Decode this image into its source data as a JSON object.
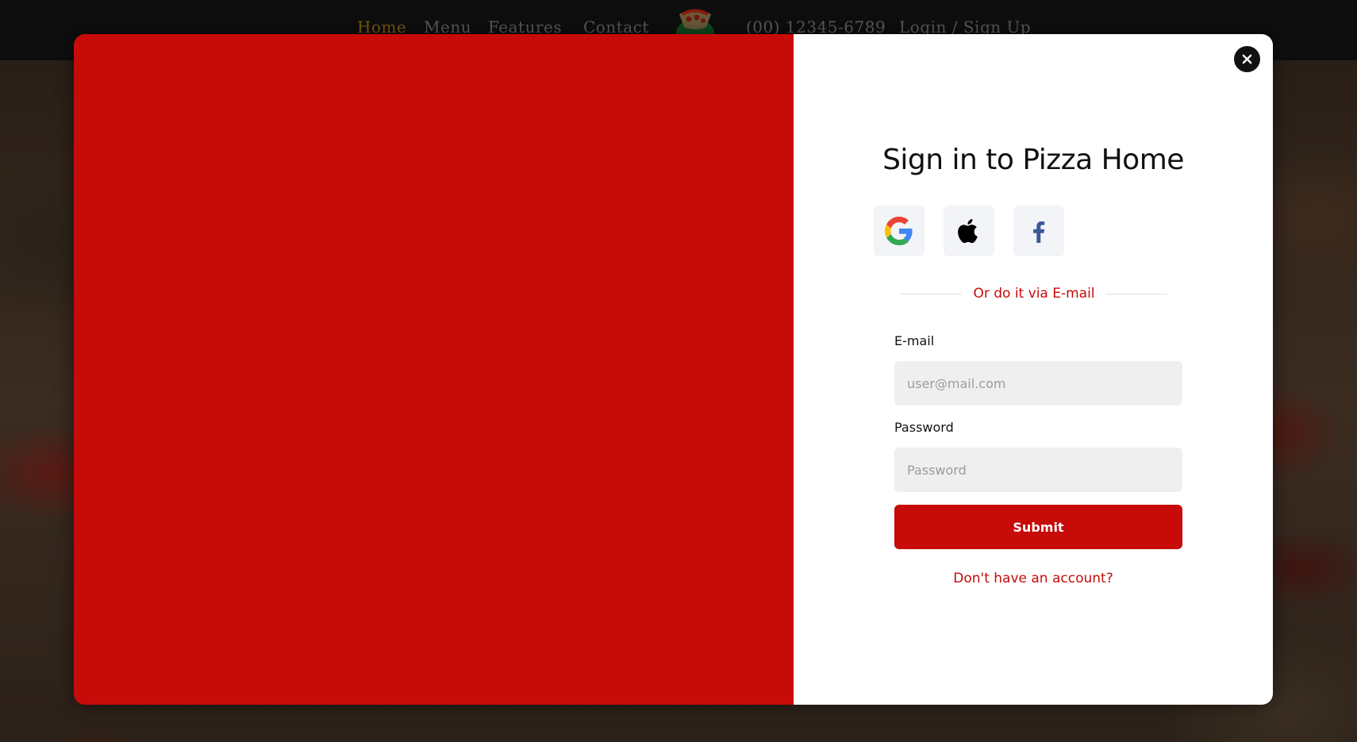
{
  "nav": {
    "links": [
      {
        "label": "Home",
        "active": true
      },
      {
        "label": "Menu"
      },
      {
        "label": "Features"
      },
      {
        "label": "Contact"
      },
      {
        "label": "(00) 12345-6789"
      },
      {
        "label": "Login / Sign Up"
      }
    ],
    "logo_icon": "pizza-logo-icon"
  },
  "modal": {
    "title": "Sign in to Pizza Home",
    "social_buttons": [
      {
        "icon": "google-icon"
      },
      {
        "icon": "apple-icon"
      },
      {
        "icon": "facebook-icon"
      }
    ],
    "divider_text": "Or do it via E-mail",
    "email": {
      "label": "E-mail",
      "placeholder": "user@mail.com",
      "value": ""
    },
    "password": {
      "label": "Password",
      "placeholder": "Password",
      "value": ""
    },
    "submit_label": "Submit",
    "signup_link": "Don't have an account?",
    "close_icon": "close-icon"
  },
  "colors": {
    "brand_red": "#c60b09",
    "nav_active": "#7a5a0c",
    "overlay_dark": "#0e0e0e"
  }
}
